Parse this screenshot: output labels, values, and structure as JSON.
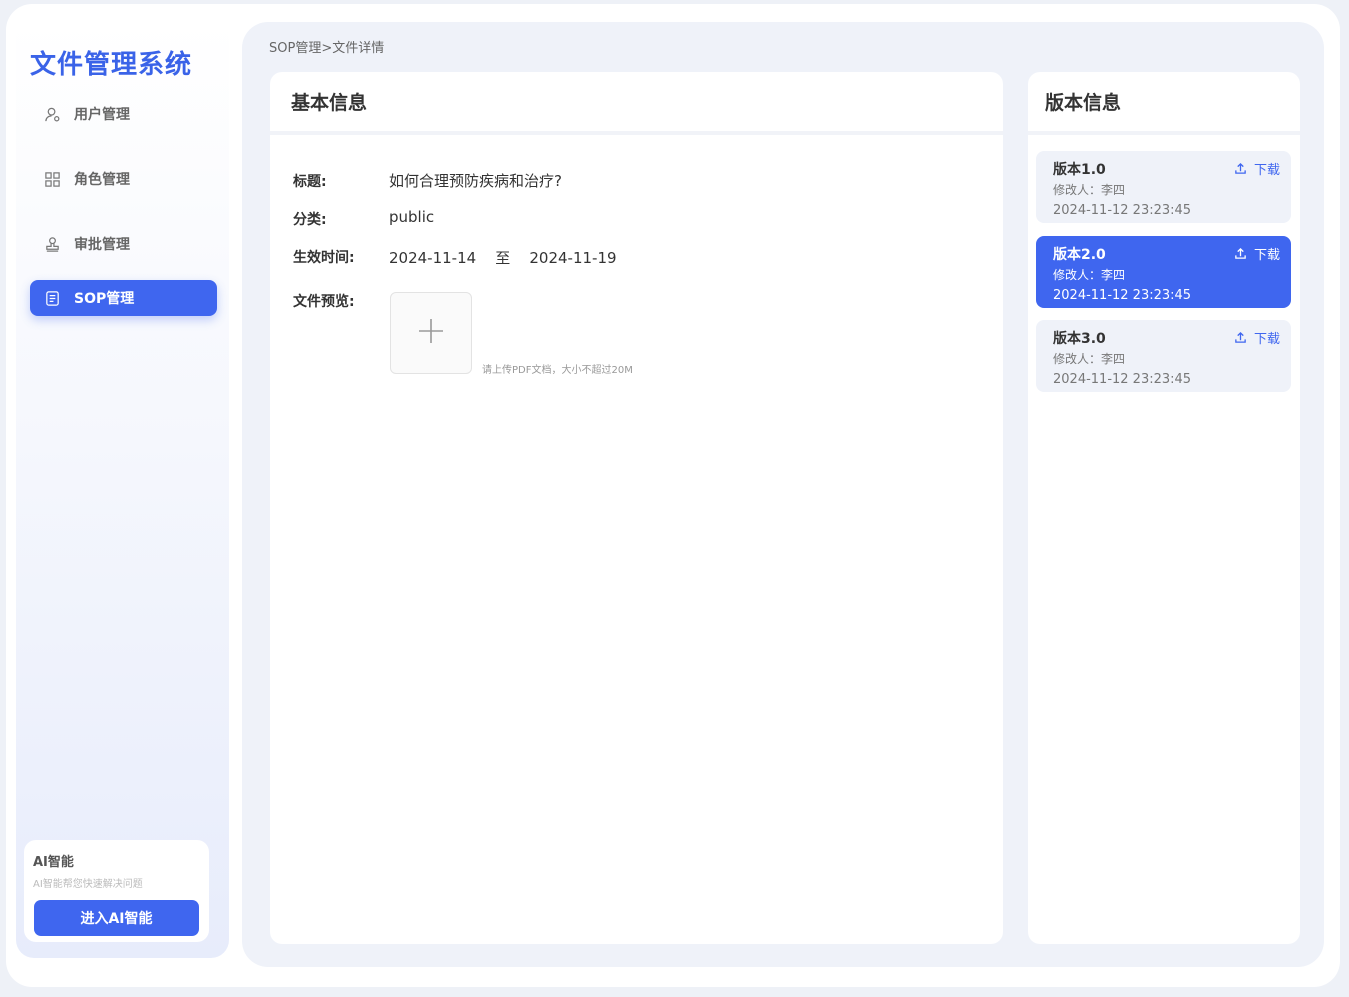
{
  "sidebar": {
    "app_title": "文件管理系统",
    "items": [
      {
        "label": "用户管理",
        "icon": "user-icon"
      },
      {
        "label": "角色管理",
        "icon": "grid-icon"
      },
      {
        "label": "审批管理",
        "icon": "stamp-icon"
      },
      {
        "label": "SOP管理",
        "icon": "document-icon",
        "active": true
      }
    ],
    "ai_card": {
      "title": "AI智能",
      "description": "AI智能帮您快速解决问题",
      "button_label": "进入AI智能"
    }
  },
  "breadcrumb": "SOP管理>文件详情",
  "basic_info": {
    "header": "基本信息",
    "fields": {
      "title_label": "标题:",
      "title_value": "如何合理预防疾病和治疗?",
      "category_label": "分类:",
      "category_value": "public",
      "effective_label": "生效时间:",
      "effective_start": "2024-11-14",
      "effective_sep": "至",
      "effective_end": "2024-11-19",
      "preview_label": "文件预览:"
    },
    "upload_hint": "请上传PDF文档，大小不超过20M"
  },
  "version_info": {
    "header": "版本信息",
    "download_label": "下载",
    "versions": [
      {
        "name": "版本1.0",
        "editor": "修改人：李四",
        "time": "2024-11-12 23:23:45",
        "active": false
      },
      {
        "name": "版本2.0",
        "editor": "修改人：李四",
        "time": "2024-11-12 23:23:45",
        "active": true
      },
      {
        "name": "版本3.0",
        "editor": "修改人：李四",
        "time": "2024-11-12 23:23:45",
        "active": false
      }
    ]
  },
  "colors": {
    "accent": "#3f66ef",
    "title_blue": "#3a63e8",
    "page_bg": "#eff2f9"
  }
}
